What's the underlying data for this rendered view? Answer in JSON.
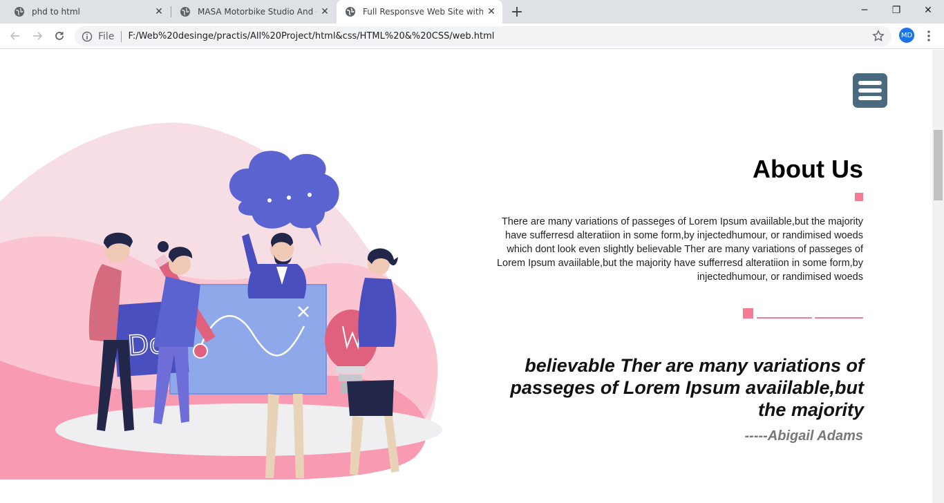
{
  "browser": {
    "tabs": [
      {
        "title": "phd to html",
        "active": false
      },
      {
        "title": "MASA Motorbike Studio And Onl",
        "active": false
      },
      {
        "title": "Full Responsve Web Site with htn",
        "active": true
      }
    ],
    "omnibox": {
      "scheme_label": "File",
      "url": "F:/Web%20desinge/practis/All%20Project/html&css/HTML%20&%20CSS/web.html"
    },
    "profile_initials": "MD",
    "close_glyph": "✕",
    "new_tab_glyph": "+",
    "window_controls": {
      "minimize": "─",
      "restore": "❐",
      "close": "✕"
    }
  },
  "page": {
    "about": {
      "title": "About Us",
      "text": "There are many variations of passeges of Lorem Ipsum avaiilable,but the majority have sufferresd alteratiion in some form,by injectedhumour, or randimised woeds which dont look even slightly believable Ther are many variations of passeges of Lorem Ipsum avaiilable,but the majority have sufferresd alteratiion in some form,by injectedhumour, or randimised woeds"
    },
    "quote": {
      "text": "believable Ther are many variations of passeges of Lorem Ipsum avaiilable,but the majority",
      "author": "-----Abigail Adams"
    }
  },
  "colors": {
    "accent_pink": "#f47c93",
    "hamburger_bg": "#4a6a80",
    "illustration_blue": "#5a63d0",
    "board_blue": "#8ea8ea"
  },
  "icons": [
    "globe-icon",
    "close-icon",
    "plus-icon",
    "back-icon",
    "forward-icon",
    "reload-icon",
    "info-icon",
    "star-icon",
    "kebab-menu-icon",
    "hamburger-menu-icon"
  ]
}
